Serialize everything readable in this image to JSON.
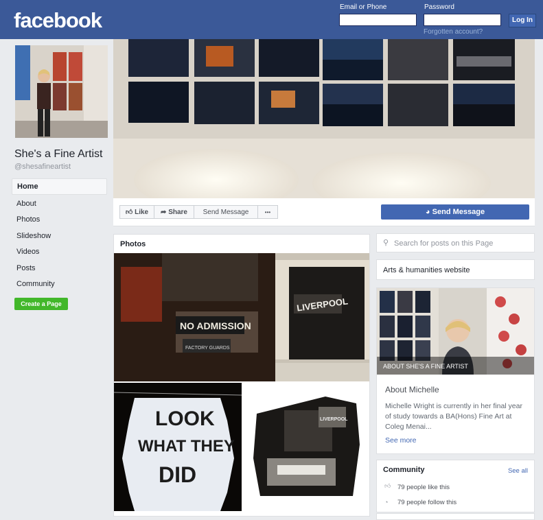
{
  "header": {
    "logo": "facebook",
    "email_label": "Email or Phone",
    "password_label": "Password",
    "login_button": "Log In",
    "forgot_link": "Forgotten account?"
  },
  "sidebar": {
    "page_name": "She's a Fine Artist",
    "handle": "@shesafineartist",
    "items": [
      {
        "label": "Home"
      },
      {
        "label": "About"
      },
      {
        "label": "Photos"
      },
      {
        "label": "Slideshow"
      },
      {
        "label": "Videos"
      },
      {
        "label": "Posts"
      },
      {
        "label": "Community"
      }
    ],
    "create_button": "Create a Page"
  },
  "actions": {
    "like": "Like",
    "share": "Share",
    "send_message_small": "Send Message",
    "more": "•••",
    "send_message": "Send Message"
  },
  "photos": {
    "title": "Photos",
    "photo1_sign1": "NO ADMISSION",
    "photo1_sign2": "LIVERPOOL",
    "photo1_sign3": "FACTORY GUARDS",
    "photo2_line1": "LOOK",
    "photo2_line2": "WHAT THEY",
    "photo2_line3": "DID",
    "photo3_text": "LIVERPOOL"
  },
  "right": {
    "search_placeholder": "Search for posts on this Page",
    "category": "Arts & humanities website",
    "about_overlay": "ABOUT SHE'S A FINE ARTIST",
    "about_title": "About Michelle",
    "about_desc": "Michelle Wright is currently in her final year of study towards a BA(Hons) Fine Art at Coleg Menai...",
    "see_more": "See more",
    "community_title": "Community",
    "see_all": "See all",
    "likes": "79 people like this",
    "follows": "79 people follow this"
  },
  "colors": {
    "brand": "#3b5998",
    "button_blue": "#4267b2",
    "create_green": "#42b72a",
    "background": "#e9ebee"
  }
}
